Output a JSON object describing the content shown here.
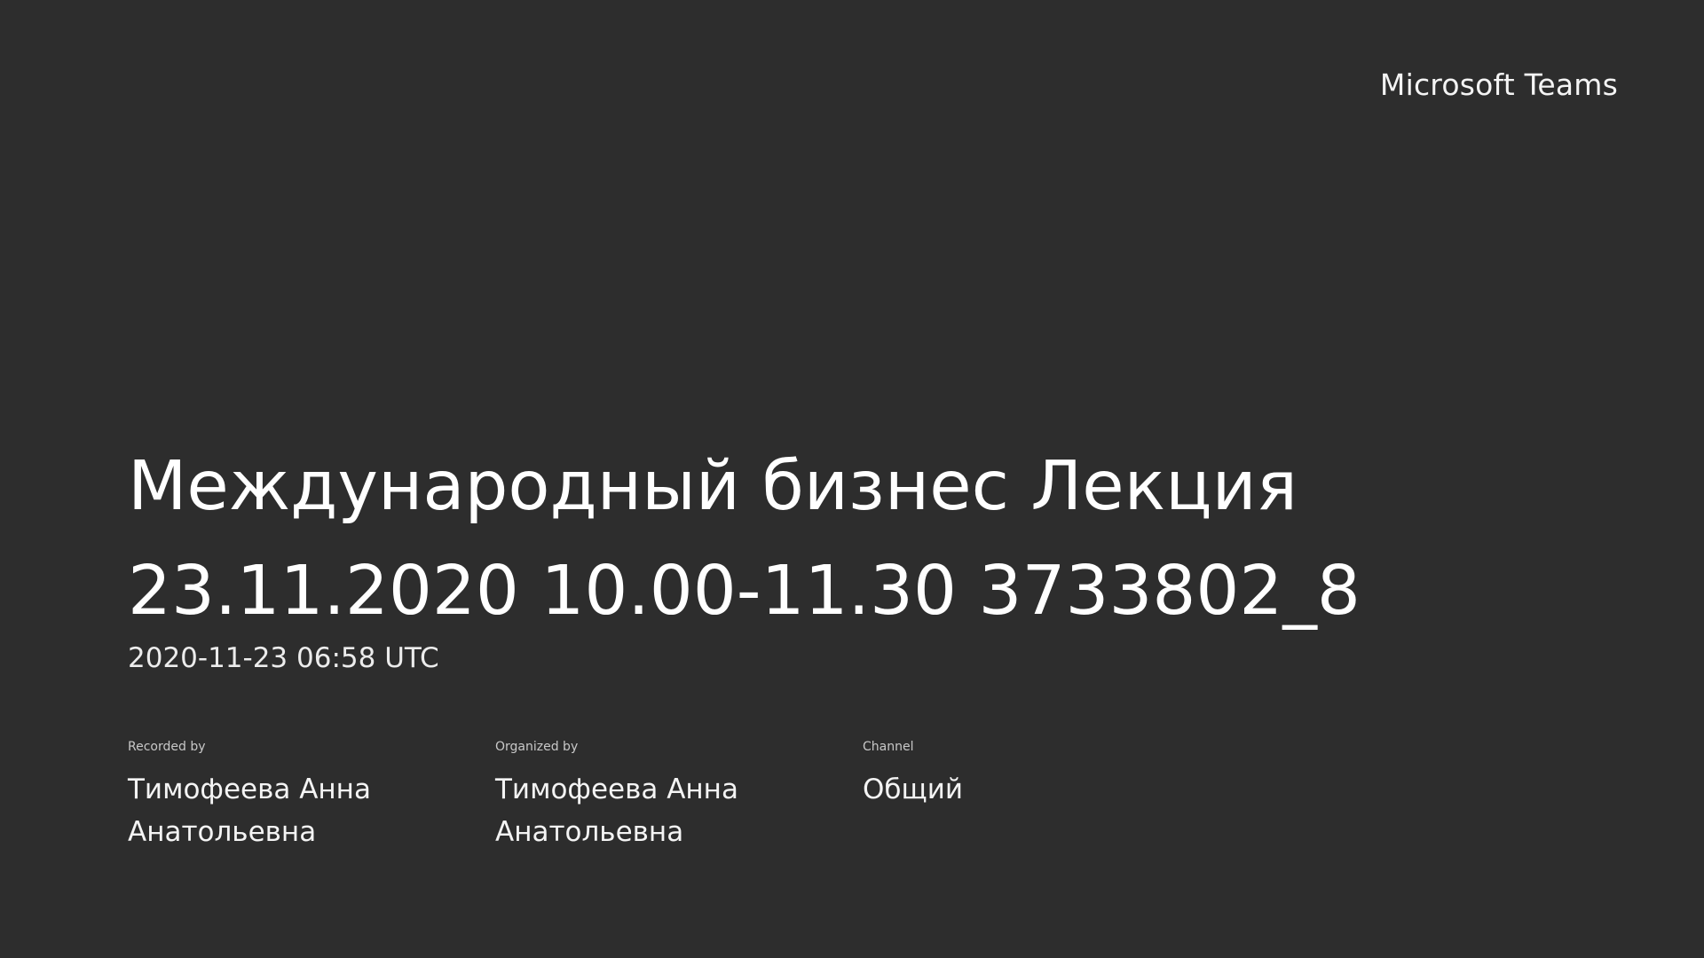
{
  "brand": {
    "name": "Microsoft Teams"
  },
  "recording": {
    "title": "Международный бизнес Лекция 23.11.2020 10.00-11.30 3733802_8",
    "timestamp": "2020-11-23 06:58 UTC"
  },
  "meta": {
    "recorded_by": {
      "label": "Recorded by",
      "value": "Тимофеева Анна Анатольевна"
    },
    "organized_by": {
      "label": "Organized by",
      "value": "Тимофеева Анна Анатольевна"
    },
    "channel": {
      "label": "Channel",
      "value": "Общий"
    }
  },
  "colors": {
    "background": "#2d2d2d",
    "text": "#ffffff"
  }
}
